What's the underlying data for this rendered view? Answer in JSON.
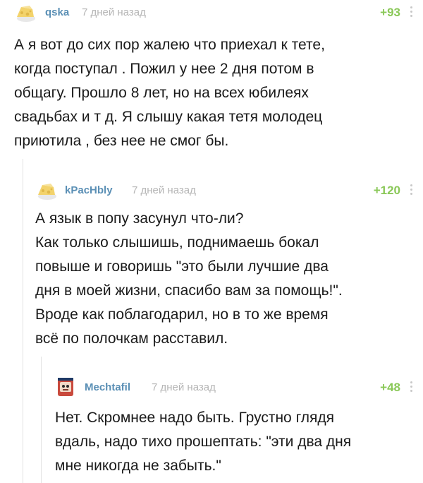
{
  "comments": [
    {
      "username": "qska",
      "time": "7 дней назад",
      "rating": "+93",
      "text": "А я вот до сих пор жалею что приехал к тете,\nкогда поступал . Пожил у нее 2 дня потом в\nобщагу. Прошло 8 лет, но на всех юбилеях\nсвадьбах и т д. Я слышу какая тетя молодец\nприютила , без нее не смог бы."
    },
    {
      "username": "kPacHbly",
      "time": "7 дней назад",
      "rating": "+120",
      "text": "А язык в попу засунул что-ли?\nКак только слышишь, поднимаешь бокал\nповыше и говоришь \"это были лучшие два\nдня в моей жизни, спасибо вам за помощь!\".\nВроде как поблагодарил, но в то же время\nвсё по полочкам расставил."
    },
    {
      "username": "Mechtafil",
      "time": "7 дней назад",
      "rating": "+48",
      "text": "Нет. Скромнее надо быть. Грустно глядя\nвдаль, надо тихо прошептать: \"эти два дня\nмне никогда не забыть.\""
    }
  ],
  "colors": {
    "username": "#5a8fb5",
    "time": "#b5b5b5",
    "rating": "#8ac858",
    "thread_line": "#e2e2e2"
  }
}
